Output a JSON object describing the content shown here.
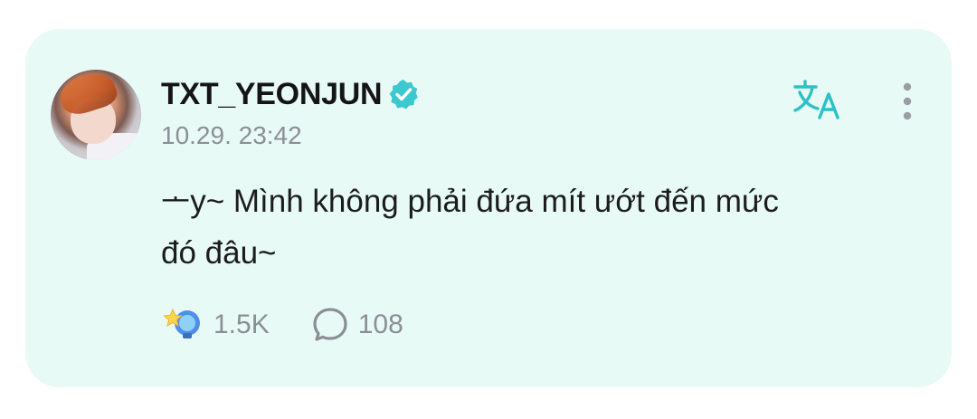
{
  "post": {
    "username": "TXT_YEONJUN",
    "verified_icon": "verified-badge-icon",
    "timestamp": "10.29. 23:42",
    "text_line_1": "ᅩy~ Mình không phải đứa mít ướt đến mức",
    "text_line_2": "đó đâu~",
    "reaction_count": "1.5K",
    "comment_count": "108"
  },
  "icons": {
    "translate": "translate-icon",
    "more": "more-vertical-icon",
    "reaction": "star-light-reaction-icon",
    "comment": "comment-bubble-icon"
  },
  "colors": {
    "card_background": "#e7faf6",
    "accent_teal": "#2cc1c4",
    "text_primary": "#151515",
    "text_secondary": "#8b8f95"
  }
}
